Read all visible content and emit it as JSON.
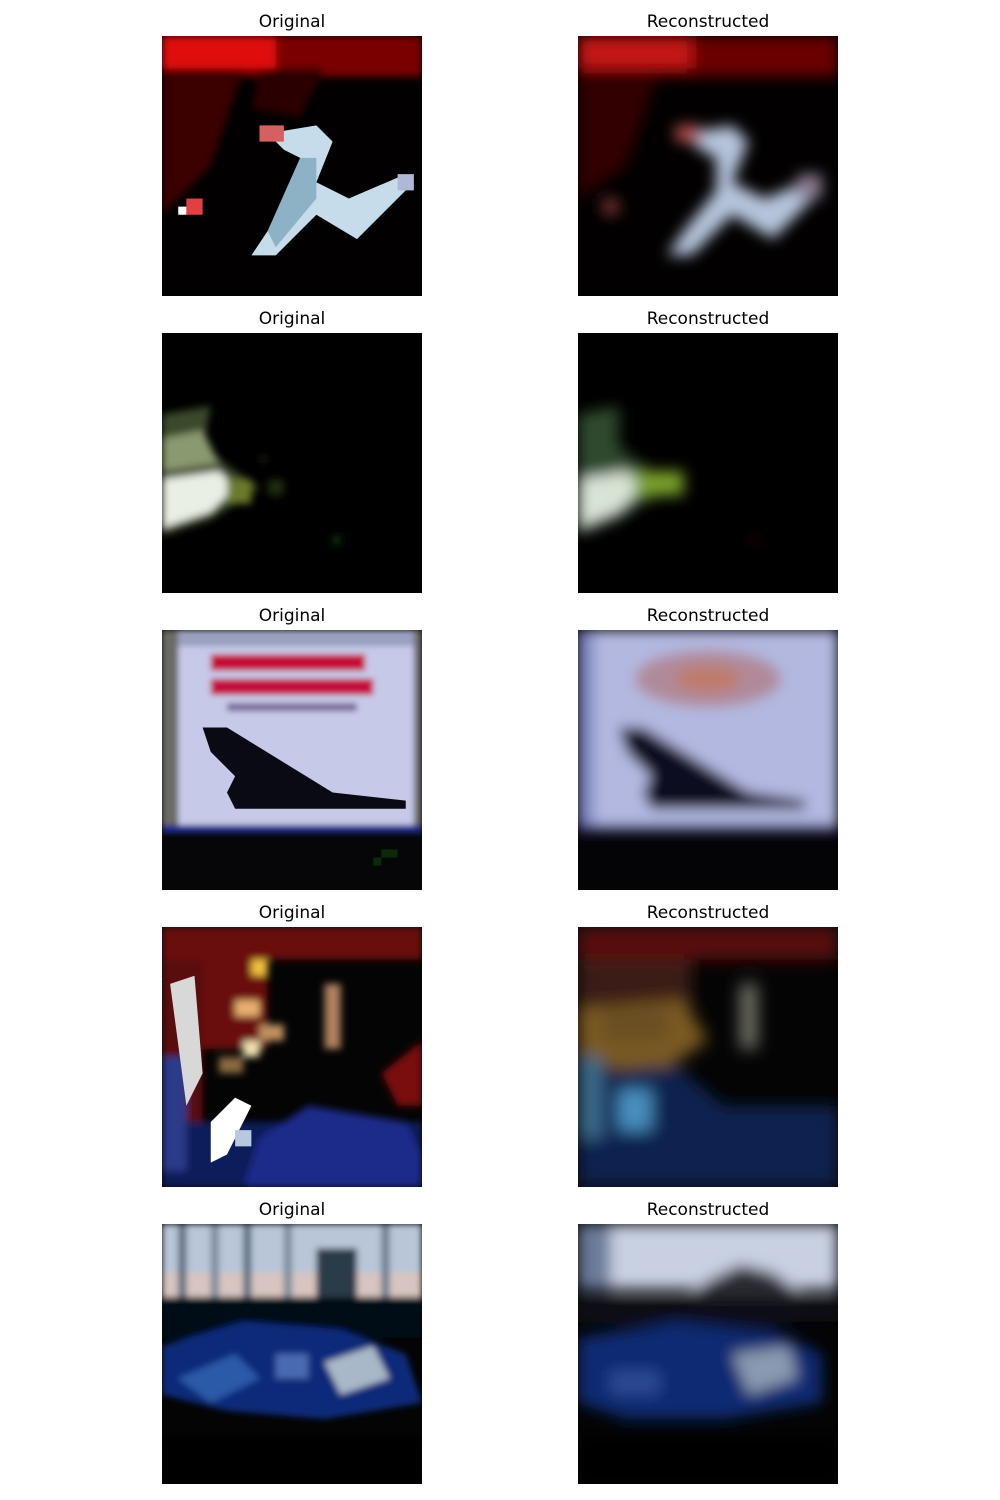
{
  "figure": {
    "rows": [
      {
        "original_title": "Original",
        "reconstructed_title": "Reconstructed"
      },
      {
        "original_title": "Original",
        "reconstructed_title": "Reconstructed"
      },
      {
        "original_title": "Original",
        "reconstructed_title": "Reconstructed"
      },
      {
        "original_title": "Original",
        "reconstructed_title": "Reconstructed"
      },
      {
        "original_title": "Original",
        "reconstructed_title": "Reconstructed"
      }
    ]
  }
}
